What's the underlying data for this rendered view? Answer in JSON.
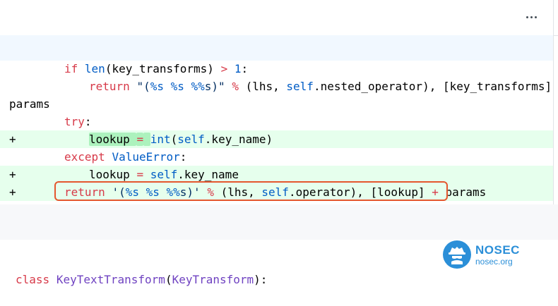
{
  "menu": {
    "icon": "kebab-horizontal-icon"
  },
  "colors": {
    "keyword": "#d73a49",
    "builtin": "#005cc5",
    "string": "#032f62",
    "class": "#6f42c1",
    "added_bg": "#e6ffed",
    "highlight_bg": "#acf2bd",
    "hunk_bg": "#f1f8ff",
    "annotation": "#e4572e",
    "logo": "#2b8fd8"
  },
  "diff": {
    "lines": [
      {
        "marker": "",
        "tokens": [
          {
            "t": "if",
            "c": "kw"
          },
          {
            "t": " "
          },
          {
            "t": "len",
            "c": "fn"
          },
          {
            "t": "(key_transforms) "
          },
          {
            "t": ">",
            "c": "kw"
          },
          {
            "t": " "
          },
          {
            "t": "1",
            "c": "fn"
          },
          {
            "t": ":"
          }
        ]
      },
      {
        "marker": "",
        "tokens": [
          {
            "t": "return",
            "c": "kw"
          },
          {
            "t": " "
          },
          {
            "t": "\"(",
            "c": "st"
          },
          {
            "t": "%s",
            "c": "fn"
          },
          {
            "t": " ",
            "c": "st"
          },
          {
            "t": "%s",
            "c": "fn"
          },
          {
            "t": " ",
            "c": "st"
          },
          {
            "t": "%%",
            "c": "fn"
          },
          {
            "t": "s)\"",
            "c": "st"
          },
          {
            "t": " "
          },
          {
            "t": "%",
            "c": "kw"
          },
          {
            "t": " (lhs, "
          },
          {
            "t": "self",
            "c": "fn"
          },
          {
            "t": ".nested_operator), [key_transforms] "
          },
          {
            "t": "+",
            "c": "kw"
          }
        ]
      },
      {
        "marker": "",
        "tokens": [
          {
            "t": "params"
          }
        ]
      },
      {
        "marker": "",
        "tokens": [
          {
            "t": "try",
            "c": "kw"
          },
          {
            "t": ":"
          }
        ]
      },
      {
        "marker": "+",
        "tokens": [
          {
            "t": "lookup ",
            "h": 1
          },
          {
            "t": "=",
            "c": "kw",
            "h": 1
          },
          {
            "t": " ",
            "h": 1
          },
          {
            "t": "int",
            "c": "fn"
          },
          {
            "t": "("
          },
          {
            "t": "self",
            "c": "fn"
          },
          {
            "t": ".key_name)"
          }
        ]
      },
      {
        "marker": "",
        "tokens": [
          {
            "t": "except",
            "c": "kw"
          },
          {
            "t": " "
          },
          {
            "t": "ValueError",
            "c": "fn"
          },
          {
            "t": ":"
          }
        ]
      },
      {
        "marker": "+",
        "tokens": [
          {
            "t": "lookup "
          },
          {
            "t": "=",
            "c": "kw"
          },
          {
            "t": " "
          },
          {
            "t": "self",
            "c": "fn"
          },
          {
            "t": ".key_name"
          }
        ]
      },
      {
        "marker": "+",
        "tokens": [
          {
            "t": "return",
            "c": "kw"
          },
          {
            "t": " "
          },
          {
            "t": "'(",
            "c": "st"
          },
          {
            "t": "%s",
            "c": "fn"
          },
          {
            "t": " ",
            "c": "st"
          },
          {
            "t": "%s",
            "c": "fn"
          },
          {
            "t": " ",
            "c": "st"
          },
          {
            "t": "%%",
            "c": "fn"
          },
          {
            "t": "s)'",
            "c": "st"
          },
          {
            "t": " "
          },
          {
            "t": "%",
            "c": "kw"
          },
          {
            "t": " (lhs, "
          },
          {
            "t": "self",
            "c": "fn"
          },
          {
            "t": ".operator), [lookup] "
          },
          {
            "t": "+",
            "c": "kw"
          },
          {
            "t": " params"
          }
        ]
      }
    ]
  },
  "next_block": {
    "tokens": [
      {
        "t": "class",
        "c": "kw"
      },
      {
        "t": " "
      },
      {
        "t": "KeyTextTransform",
        "c": "cls"
      },
      {
        "t": "("
      },
      {
        "t": "KeyTransform",
        "c": "cls"
      },
      {
        "t": "):"
      }
    ]
  },
  "watermark": {
    "name": "NOSEC",
    "domain": "nosec.org",
    "icon": "spy-hat-icon"
  }
}
